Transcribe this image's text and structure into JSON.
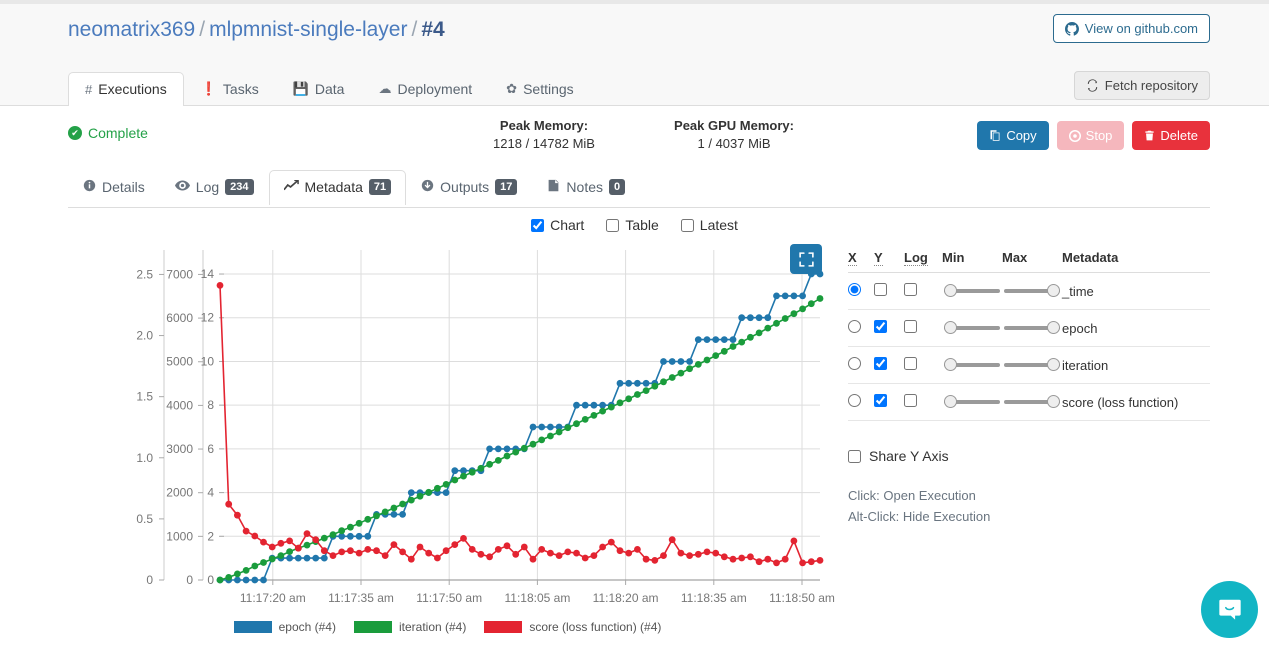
{
  "header": {
    "breadcrumb": {
      "owner": "neomatrix369",
      "repo": "mlpmnist-single-layer",
      "run": "#4",
      "separator": "/"
    },
    "github_button": "View on github.com",
    "fetch_button": "Fetch repository"
  },
  "main_tabs": [
    {
      "label": "Executions",
      "icon": "hash-icon",
      "active": true
    },
    {
      "label": "Tasks",
      "icon": "exclamation-icon",
      "active": false
    },
    {
      "label": "Data",
      "icon": "save-icon",
      "active": false
    },
    {
      "label": "Deployment",
      "icon": "cloud-icon",
      "active": false
    },
    {
      "label": "Settings",
      "icon": "gear-icon",
      "active": false
    }
  ],
  "status": {
    "state": "Complete",
    "peak_memory": {
      "label": "Peak Memory:",
      "value": "1218 / 14782 MiB"
    },
    "peak_gpu_memory": {
      "label": "Peak GPU Memory:",
      "value": "1 / 4037 MiB"
    },
    "actions": [
      {
        "label": "Copy",
        "icon": "copy-icon",
        "style": "primary"
      },
      {
        "label": "Stop",
        "icon": "stop-circle-icon",
        "style": "disabled"
      },
      {
        "label": "Delete",
        "icon": "trash-icon",
        "style": "danger"
      }
    ]
  },
  "sub_tabs": [
    {
      "label": "Details",
      "icon": "info-icon",
      "badge": null,
      "active": false
    },
    {
      "label": "Log",
      "icon": "eye-icon",
      "badge": "234",
      "active": false
    },
    {
      "label": "Metadata",
      "icon": "chart-line-icon",
      "badge": "71",
      "active": true
    },
    {
      "label": "Outputs",
      "icon": "download-icon",
      "badge": "17",
      "active": false
    },
    {
      "label": "Notes",
      "icon": "note-icon",
      "badge": "0",
      "active": false
    }
  ],
  "view_toggles": [
    {
      "label": "Chart",
      "checked": true
    },
    {
      "label": "Table",
      "checked": false
    },
    {
      "label": "Latest",
      "checked": false
    }
  ],
  "metadata_table": {
    "columns": [
      "X",
      "Y",
      "Log",
      "Min",
      "Max",
      "Metadata"
    ],
    "rows": [
      {
        "name": "_time",
        "x": true,
        "y": false,
        "log": false,
        "min": 0,
        "max": 100
      },
      {
        "name": "epoch",
        "x": false,
        "y": true,
        "log": false,
        "min": 0,
        "max": 100
      },
      {
        "name": "iteration",
        "x": false,
        "y": true,
        "log": false,
        "min": 0,
        "max": 100
      },
      {
        "name": "score (loss function)",
        "x": false,
        "y": true,
        "log": false,
        "min": 0,
        "max": 100
      }
    ]
  },
  "share_y_axis": {
    "label": "Share Y Axis",
    "checked": false
  },
  "hints": {
    "click": "Click: Open Execution",
    "alt_click": "Alt-Click: Hide Execution"
  },
  "expand_button": {
    "icon": "expand-icon"
  },
  "chat_widget": {
    "icon": "chat-smile-icon",
    "color": "#12b5c4"
  },
  "chart_data": {
    "type": "line",
    "title": "",
    "xlabel": "",
    "ylabel": "",
    "grid": true,
    "legend_position": "bottom",
    "x_axis": {
      "type": "time",
      "tick_labels": [
        "11:17:20 am",
        "11:17:35 am",
        "11:17:50 am",
        "11:18:05 am",
        "11:18:20 am",
        "11:18:35 am",
        "11:18:50 am"
      ],
      "tick_positions": [
        0.088,
        0.235,
        0.382,
        0.529,
        0.676,
        0.823,
        0.97
      ]
    },
    "y_axes": [
      {
        "id": "score-axis",
        "ticks": [
          0,
          0.5,
          1.0,
          1.5,
          2.0,
          2.5
        ],
        "tick_labels": [
          "0",
          "0.5",
          "1.0",
          "1.5",
          "2.0",
          "2.5"
        ],
        "range": [
          0,
          2.7
        ],
        "series": "score (loss function) (#4)",
        "color": "#e32431"
      },
      {
        "id": "iteration-axis",
        "ticks": [
          0,
          1000,
          2000,
          3000,
          4000,
          5000,
          6000,
          7000
        ],
        "tick_labels": [
          "0",
          "1000",
          "2000",
          "3000",
          "4000",
          "5000",
          "6000",
          "7000"
        ],
        "range": [
          0,
          7560
        ],
        "series": "iteration (#4)",
        "color": "#1a9c3c"
      },
      {
        "id": "epoch-axis",
        "ticks": [
          0,
          2,
          4,
          6,
          8,
          10,
          12,
          14
        ],
        "tick_labels": [
          "0",
          "2",
          "4",
          "6",
          "8",
          "10",
          "12",
          "14"
        ],
        "range": [
          0,
          15.1
        ],
        "series": "epoch (#4)",
        "color": "#2077ac"
      }
    ],
    "legend": [
      {
        "label": "epoch (#4)",
        "color": "#2077ac"
      },
      {
        "label": "iteration (#4)",
        "color": "#1a9c3c"
      },
      {
        "label": "score (loss function) (#4)",
        "color": "#e32431"
      }
    ],
    "series": [
      {
        "name": "epoch (#4)",
        "color": "#2077ac",
        "axis": "epoch-axis",
        "values": [
          0,
          0,
          0,
          0,
          0,
          0,
          1,
          1,
          1,
          1,
          1,
          1,
          1,
          2,
          2,
          2,
          2,
          2,
          3,
          3,
          3,
          3,
          4,
          4,
          4,
          4,
          4,
          5,
          5,
          5,
          5,
          6,
          6,
          6,
          6,
          6,
          7,
          7,
          7,
          7,
          7,
          8,
          8,
          8,
          8,
          8,
          9,
          9,
          9,
          9,
          9,
          10,
          10,
          10,
          10,
          11,
          11,
          11,
          11,
          11,
          12,
          12,
          12,
          12,
          13,
          13,
          13,
          13,
          14,
          14
        ]
      },
      {
        "name": "iteration (#4)",
        "color": "#1a9c3c",
        "axis": "iteration-axis",
        "values": [
          0,
          60,
          140,
          220,
          320,
          400,
          480,
          560,
          650,
          730,
          800,
          880,
          960,
          1040,
          1130,
          1210,
          1300,
          1390,
          1470,
          1560,
          1650,
          1740,
          1830,
          1920,
          2010,
          2100,
          2190,
          2290,
          2380,
          2470,
          2560,
          2650,
          2740,
          2840,
          2930,
          3020,
          3110,
          3210,
          3300,
          3390,
          3490,
          3580,
          3680,
          3770,
          3870,
          3960,
          4060,
          4150,
          4250,
          4340,
          4440,
          4540,
          4640,
          4740,
          4840,
          4940,
          5040,
          5140,
          5240,
          5350,
          5450,
          5560,
          5660,
          5770,
          5880,
          5990,
          6100,
          6210,
          6330,
          6450
        ]
      },
      {
        "name": "score (loss function) (#4)",
        "color": "#e32431",
        "axis": "score-axis",
        "values": [
          2.41,
          0.62,
          0.53,
          0.4,
          0.36,
          0.31,
          0.27,
          0.3,
          0.32,
          0.26,
          0.38,
          0.33,
          0.24,
          0.2,
          0.23,
          0.24,
          0.22,
          0.25,
          0.24,
          0.2,
          0.29,
          0.23,
          0.17,
          0.27,
          0.22,
          0.18,
          0.24,
          0.29,
          0.34,
          0.25,
          0.21,
          0.19,
          0.25,
          0.28,
          0.21,
          0.27,
          0.17,
          0.25,
          0.22,
          0.2,
          0.23,
          0.22,
          0.18,
          0.2,
          0.27,
          0.31,
          0.24,
          0.22,
          0.25,
          0.17,
          0.16,
          0.2,
          0.33,
          0.22,
          0.2,
          0.21,
          0.23,
          0.22,
          0.19,
          0.17,
          0.18,
          0.19,
          0.15,
          0.17,
          0.14,
          0.17,
          0.32,
          0.14,
          0.15,
          0.16
        ]
      }
    ]
  }
}
